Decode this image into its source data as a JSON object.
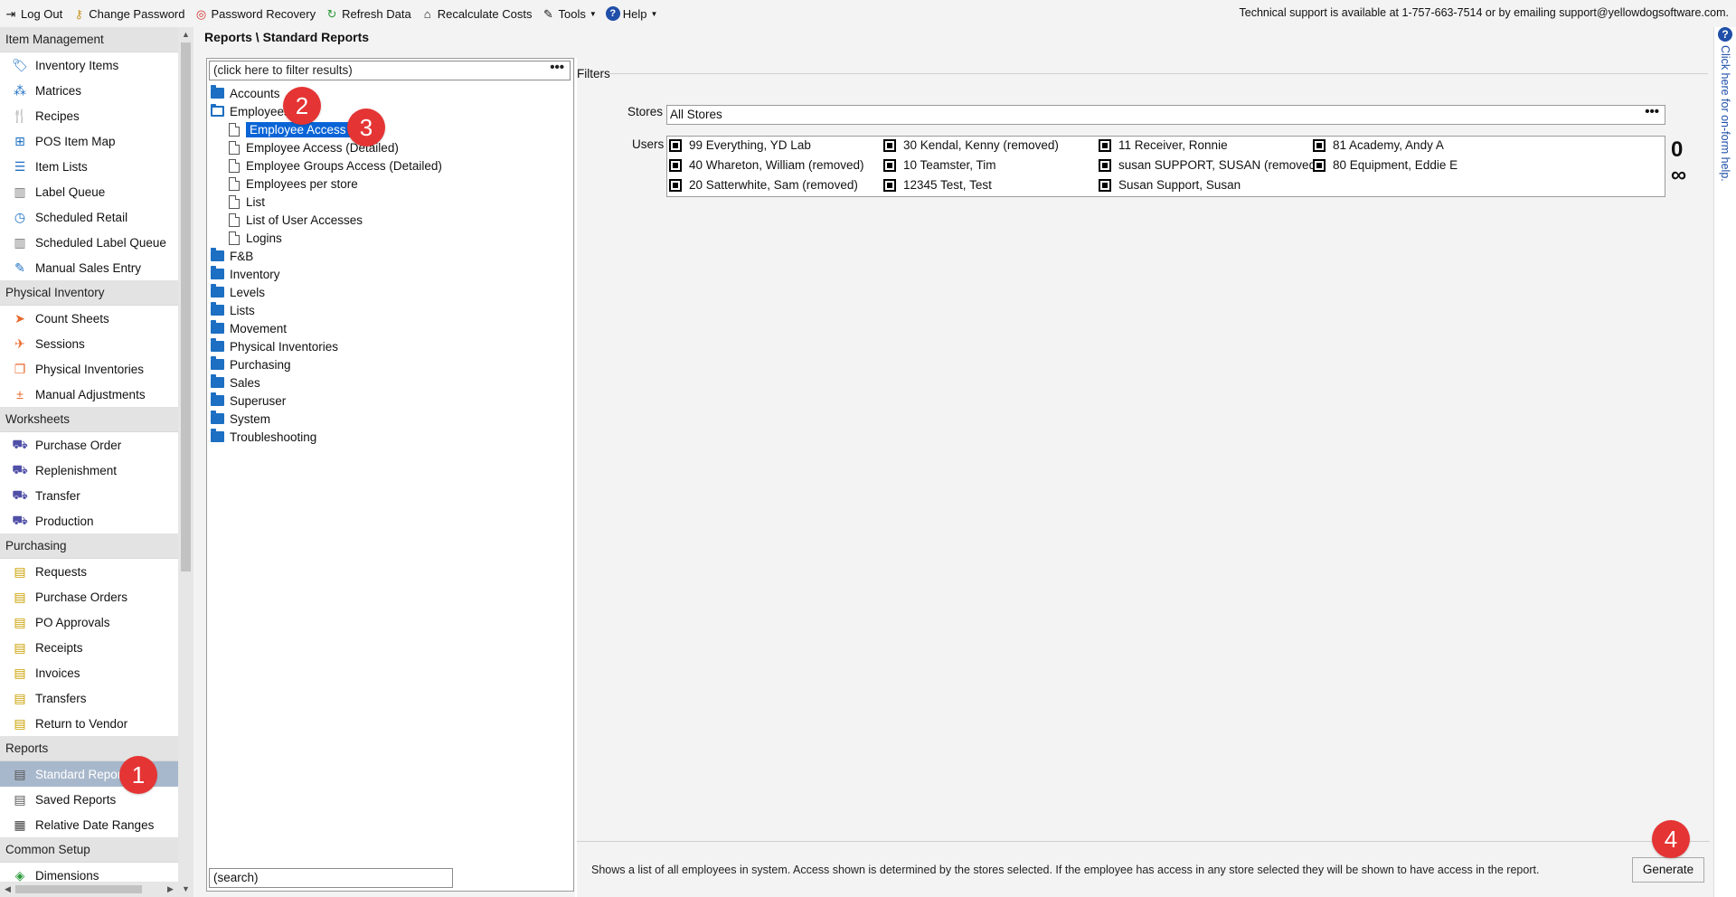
{
  "toolbar": {
    "items": [
      {
        "label": "Log Out",
        "icon": "logout-icon"
      },
      {
        "label": "Change Password",
        "icon": "key-icon"
      },
      {
        "label": "Password Recovery",
        "icon": "lifebuoy-icon"
      },
      {
        "label": "Refresh Data",
        "icon": "refresh-icon"
      },
      {
        "label": "Recalculate Costs",
        "icon": "bank-icon"
      },
      {
        "label": "Tools",
        "icon": "wrench-icon"
      },
      {
        "label": "Help",
        "icon": "help-icon"
      }
    ],
    "support_text": "Technical support is available at 1-757-663-7514 or by emailing support@yellowdogsoftware.com."
  },
  "sidebar": {
    "sections": [
      {
        "title": "Item Management",
        "items": [
          "Inventory Items",
          "Matrices",
          "Recipes",
          "POS Item Map",
          "Item Lists",
          "Label Queue",
          "Scheduled Retail",
          "Scheduled Label Queue",
          "Manual Sales Entry"
        ]
      },
      {
        "title": "Physical Inventory",
        "items": [
          "Count Sheets",
          "Sessions",
          "Physical Inventories",
          "Manual Adjustments"
        ]
      },
      {
        "title": "Worksheets",
        "items": [
          "Purchase Order",
          "Replenishment",
          "Transfer",
          "Production"
        ]
      },
      {
        "title": "Purchasing",
        "items": [
          "Requests",
          "Purchase Orders",
          "PO Approvals",
          "Receipts",
          "Invoices",
          "Transfers",
          "Return to Vendor"
        ]
      },
      {
        "title": "Reports",
        "items": [
          "Standard Reports",
          "Saved Reports",
          "Relative Date Ranges"
        ]
      },
      {
        "title": "Common Setup",
        "items": [
          "Dimensions"
        ]
      }
    ],
    "active_item": "Standard Reports",
    "icon_colors": {
      "accent": "#1c6fc2",
      "orange": "#e8692c",
      "yellow": "#e6c42a",
      "red": "#c8302c"
    }
  },
  "breadcrumb": "Reports \\ Standard Reports",
  "tree": {
    "filter_placeholder": "(click here to filter results)",
    "search_placeholder": "(search)",
    "folders": [
      "Accounts",
      "Employees",
      "F&B",
      "Inventory",
      "Levels",
      "Lists",
      "Movement",
      "Physical Inventories",
      "Purchasing",
      "Sales",
      "Superuser",
      "System",
      "Troubleshooting"
    ],
    "open_folder": "Employees",
    "employees_children": [
      "Employee Access",
      "Employee Access (Detailed)",
      "Employee Groups Access (Detailed)",
      "Employees per store",
      "List",
      "List of User Accesses",
      "Logins"
    ],
    "selected": "Employee Access"
  },
  "filters": {
    "legend": "Filters",
    "stores_label": "Stores",
    "stores_value": "All Stores",
    "users_label": "Users",
    "users": [
      "99 Everything, YD Lab",
      "30 Kendal, Kenny (removed)",
      "11 Receiver, Ronnie",
      "81 Academy, Andy A",
      "40 Whareton, William (removed)",
      "10 Teamster, Tim",
      "susan SUPPORT, SUSAN (removed)",
      "80 Equipment, Eddie E",
      "20 Satterwhite, Sam (removed)",
      "12345 Test, Test",
      "Susan Support, Susan"
    ],
    "infinity_symbol": "0 ∞"
  },
  "description": "Shows a list of all employees in system. Access shown is determined by the stores selected.  If the employee has access in any store selected they will be shown to have access in the report.",
  "generate_label": "Generate",
  "help_strip": {
    "text": "Click here for on-form help."
  },
  "markers": [
    "1",
    "2",
    "3",
    "4"
  ],
  "colors": {
    "selected_bg": "#0a64d6",
    "marker": "#e53434",
    "active_sidebar": "#a8b8cc"
  }
}
